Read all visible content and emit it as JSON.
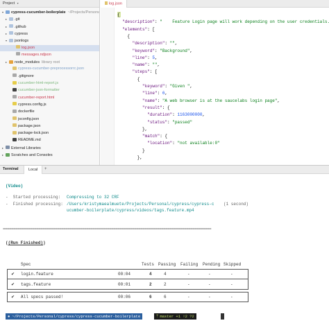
{
  "project": {
    "title": "Project",
    "items": [
      {
        "label": "cypress-cucumber-boilerplate",
        "suffix": "~/Projects/Personal",
        "arrow": "▾",
        "icon": "folder-blue",
        "indent": 0
      },
      {
        "label": ".git",
        "arrow": "▸",
        "icon": "folder",
        "indent": 1
      },
      {
        "label": ".github",
        "arrow": "▸",
        "icon": "folder",
        "indent": 1
      },
      {
        "label": "cypress",
        "arrow": "▸",
        "icon": "folder",
        "indent": 1
      },
      {
        "label": "jsonlogs",
        "arrow": "▾",
        "icon": "folder",
        "indent": 1
      },
      {
        "label": "log.json",
        "arrow": "",
        "icon": "file-json",
        "indent": 3,
        "style": "red selected"
      },
      {
        "label": "messages.ndjson",
        "arrow": "",
        "icon": "file-gray",
        "indent": 3,
        "style": "red"
      },
      {
        "label": "node_modules",
        "suffix": "library root",
        "arrow": "▸",
        "icon": "folder-orange",
        "indent": 1
      },
      {
        "label": "cypress-cucumber-preprocessorrc.json",
        "arrow": "",
        "icon": "file-json",
        "indent": 2,
        "style": "ghost-blue"
      },
      {
        "label": ".gitignore",
        "arrow": "",
        "icon": "file-gray",
        "indent": 2
      },
      {
        "label": "cucumber-html-report.js",
        "arrow": "",
        "icon": "file-js",
        "indent": 2,
        "style": "ghost-green"
      },
      {
        "label": "cucumber-json-formatter",
        "arrow": "",
        "icon": "file-md",
        "indent": 2,
        "style": "ghost-green"
      },
      {
        "label": "cucumber-report.html",
        "arrow": "",
        "icon": "file-gray",
        "indent": 2,
        "style": "red"
      },
      {
        "label": "cypress.config.js",
        "arrow": "",
        "icon": "file-js",
        "indent": 2
      },
      {
        "label": "dockerfile",
        "arrow": "",
        "icon": "file-gray",
        "indent": 2
      },
      {
        "label": "jsconfig.json",
        "arrow": "",
        "icon": "file-json",
        "indent": 2
      },
      {
        "label": "package.json",
        "arrow": "",
        "icon": "file-json",
        "indent": 2
      },
      {
        "label": "package-lock.json",
        "arrow": "",
        "icon": "file-json",
        "indent": 2
      },
      {
        "label": "README.md",
        "arrow": "",
        "icon": "file-md",
        "indent": 2
      },
      {
        "label": "External Libraries",
        "arrow": "▸",
        "icon": "libs",
        "indent": 0
      },
      {
        "label": "Scratches and Consoles",
        "arrow": "▸",
        "icon": "file-green",
        "indent": 0
      }
    ]
  },
  "editor": {
    "tab": "log.json",
    "lines": [
      [
        [
          "{",
          ""
        ]
      ],
      [
        [
          "  ",
          ""
        ],
        [
          "\"description\"",
          "k"
        ],
        [
          ": ",
          ""
        ],
        [
          "\"    Feature Login page will work depending on the user credentials.",
          "s"
        ]
      ],
      [
        [
          "  ",
          ""
        ],
        [
          "\"elements\"",
          "k"
        ],
        [
          ": [",
          ""
        ]
      ],
      [
        [
          "    {",
          ""
        ]
      ],
      [
        [
          "      ",
          ""
        ],
        [
          "\"description\"",
          "k"
        ],
        [
          ": ",
          ""
        ],
        [
          "\"\"",
          "s"
        ],
        [
          ",",
          ""
        ]
      ],
      [
        [
          "      ",
          ""
        ],
        [
          "\"keyword\"",
          "k"
        ],
        [
          ": ",
          ""
        ],
        [
          "\"Background\"",
          "s"
        ],
        [
          ",",
          ""
        ]
      ],
      [
        [
          "      ",
          ""
        ],
        [
          "\"line\"",
          "k"
        ],
        [
          ": ",
          ""
        ],
        [
          "5",
          "n"
        ],
        [
          ",",
          ""
        ]
      ],
      [
        [
          "      ",
          ""
        ],
        [
          "\"name\"",
          "k"
        ],
        [
          ": ",
          ""
        ],
        [
          "\"\"",
          "s"
        ],
        [
          ",",
          ""
        ]
      ],
      [
        [
          "      ",
          ""
        ],
        [
          "\"steps\"",
          "k"
        ],
        [
          ": [",
          ""
        ]
      ],
      [
        [
          "        {",
          ""
        ]
      ],
      [
        [
          "          ",
          ""
        ],
        [
          "\"keyword\"",
          "k"
        ],
        [
          ": ",
          ""
        ],
        [
          "\"Given \"",
          "s"
        ],
        [
          ",",
          ""
        ]
      ],
      [
        [
          "          ",
          ""
        ],
        [
          "\"line\"",
          "k"
        ],
        [
          ": ",
          ""
        ],
        [
          "6",
          "n"
        ],
        [
          ",",
          ""
        ]
      ],
      [
        [
          "          ",
          ""
        ],
        [
          "\"name\"",
          "k"
        ],
        [
          ": ",
          ""
        ],
        [
          "\"A web browser is at the saucelabs login page\"",
          "s"
        ],
        [
          ",",
          ""
        ]
      ],
      [
        [
          "          ",
          ""
        ],
        [
          "\"result\"",
          "k"
        ],
        [
          ": {",
          ""
        ]
      ],
      [
        [
          "            ",
          ""
        ],
        [
          "\"duration\"",
          "k"
        ],
        [
          ": ",
          ""
        ],
        [
          "1163000000",
          "n"
        ],
        [
          ",",
          ""
        ]
      ],
      [
        [
          "            ",
          ""
        ],
        [
          "\"status\"",
          "k"
        ],
        [
          ": ",
          ""
        ],
        [
          "\"passed\"",
          "s"
        ]
      ],
      [
        [
          "          },",
          ""
        ]
      ],
      [
        [
          "          ",
          ""
        ],
        [
          "\"match\"",
          "k"
        ],
        [
          ": {",
          ""
        ]
      ],
      [
        [
          "            ",
          ""
        ],
        [
          "\"location\"",
          "k"
        ],
        [
          ": ",
          ""
        ],
        [
          "\"not available:0\"",
          "s"
        ]
      ],
      [
        [
          "          }",
          ""
        ]
      ],
      [
        [
          "        },",
          ""
        ]
      ]
    ]
  },
  "terminal": {
    "title": "Terminal",
    "tab": "Local",
    "add": "+",
    "video_label": "(Video)",
    "started_prefix": "-  Started processing:",
    "started_value": "Compressing to 32 CRF",
    "finished_prefix": "-  Finished processing:",
    "finished_path_1": "/Users/kristymaealmuete/Projects/Personal/cypress/cypress-c",
    "finished_time": "(1 second)",
    "finished_path_2": "ucumber-boilerplate/cypress/videos/tags.feature.mp4",
    "divider": "====================================================================================================",
    "run_finished": "(Run Finished)",
    "table": {
      "headers": [
        "Spec",
        "",
        "Tests",
        "Passing",
        "Failing",
        "Pending",
        "Skipped"
      ],
      "rows": [
        {
          "mark": "✔",
          "spec": "login.feature",
          "time": "00:04",
          "tests": "4",
          "passing": "4",
          "failing": "-",
          "pending": "-",
          "skipped": "-"
        },
        {
          "mark": "✔",
          "spec": "tags.feature",
          "time": "00:01",
          "tests": "2",
          "passing": "2",
          "failing": "-",
          "pending": "-",
          "skipped": "-"
        }
      ],
      "summary": {
        "mark": "✔",
        "text": "All specs passed!",
        "time": "00:06",
        "tests": "6",
        "passing": "6",
        "failing": "-",
        "pending": "-",
        "skipped": "-"
      }
    },
    "prompt_path": "~/Projects/Personal/cypress/cypress-cucumber-boilerplate",
    "prompt_git": "master +1 !2 ?2"
  }
}
